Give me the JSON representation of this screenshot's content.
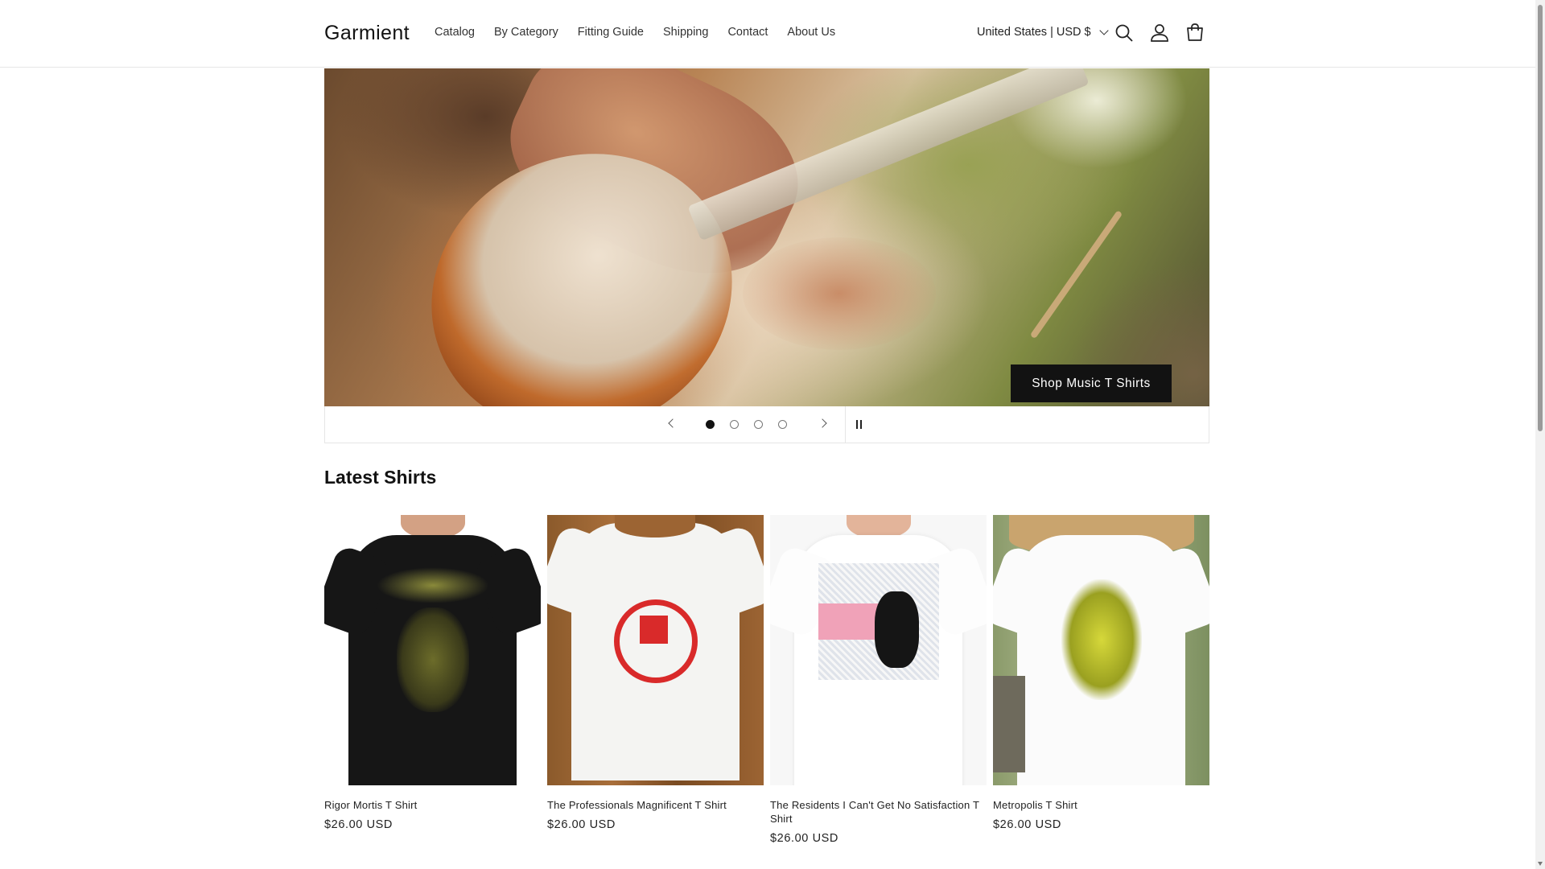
{
  "header": {
    "logo": "Garmient",
    "nav": [
      {
        "label": "Catalog"
      },
      {
        "label": "By Category"
      },
      {
        "label": "Fitting Guide"
      },
      {
        "label": "Shipping"
      },
      {
        "label": "Contact"
      },
      {
        "label": "About Us"
      }
    ],
    "locale": "United States | USD $",
    "icons": [
      "search-icon",
      "account-icon",
      "cart-icon"
    ]
  },
  "slideshow": {
    "button_label": "Shop Music T Shirts",
    "slide_count": 4,
    "active_slide": 1,
    "controls": [
      "previous-slide",
      "next-slide",
      "pause"
    ]
  },
  "latest": {
    "title": "Latest Shirts",
    "products": [
      {
        "name": "Rigor Mortis T Shirt",
        "price": "$26.00 USD"
      },
      {
        "name": "The Professionals Magnificent T Shirt",
        "price": "$26.00 USD"
      },
      {
        "name": "The Residents I Can't Get No Satisfaction T Shirt",
        "price": "$26.00 USD"
      },
      {
        "name": "Metropolis T Shirt",
        "price": "$26.00 USD"
      }
    ]
  },
  "colors": {
    "accent": "#121212",
    "background": "#ffffff",
    "border": "#e6e6e6"
  }
}
